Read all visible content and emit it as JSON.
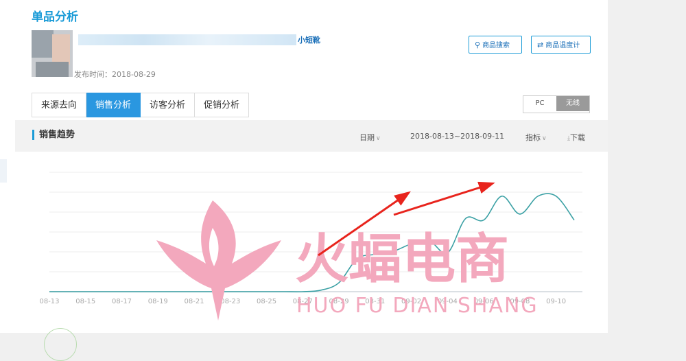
{
  "page": {
    "title": "单品分析",
    "product_name_suffix": "小短靴",
    "publish_date": "发布时间：2018-08-29"
  },
  "buttons": {
    "search_label": "商品搜索",
    "temperature_label": "商品温度计"
  },
  "tabs": [
    {
      "label": "来源去向",
      "active": false
    },
    {
      "label": "销售分析",
      "active": true
    },
    {
      "label": "访客分析",
      "active": false
    },
    {
      "label": "促销分析",
      "active": false
    }
  ],
  "device_toggle": [
    {
      "label": "PC",
      "active": false
    },
    {
      "label": "无线",
      "active": true
    }
  ],
  "trend": {
    "title": "销售趋势",
    "date_label": "日期",
    "date_range": "2018-08-13~2018-09-11",
    "metric_label": "指标",
    "download_label": "下载"
  },
  "colors": {
    "accent": "#1a9bd7",
    "tab_active": "#2a97e0",
    "line": "#3aa0a4",
    "arrow": "#e8241d",
    "watermark": "#f3a8bd"
  },
  "chart_data": {
    "type": "line",
    "x_tick_labels": [
      "08-13",
      "08-15",
      "08-17",
      "08-19",
      "08-21",
      "08-23",
      "08-25",
      "08-27",
      "08-29",
      "08-31",
      "09-02",
      "09-04",
      "09-06",
      "09-08",
      "09-10"
    ],
    "x": [
      "08-13",
      "08-14",
      "08-15",
      "08-16",
      "08-17",
      "08-18",
      "08-19",
      "08-20",
      "08-21",
      "08-22",
      "08-23",
      "08-24",
      "08-25",
      "08-26",
      "08-27",
      "08-28",
      "08-29",
      "08-30",
      "08-31",
      "09-01",
      "09-02",
      "09-03",
      "09-04",
      "09-05",
      "09-06",
      "09-07",
      "09-08",
      "09-09",
      "09-10",
      "09-11"
    ],
    "series": [
      {
        "values": [
          0,
          0,
          0,
          0,
          0,
          0,
          0,
          0,
          0,
          0,
          0,
          0,
          0,
          0,
          0,
          0.05,
          0.3,
          1.1,
          1.25,
          1.35,
          1.6,
          1.7,
          1.3,
          2.45,
          2.4,
          3.2,
          2.6,
          3.2,
          3.2,
          2.4
        ]
      }
    ],
    "ylim": [
      0,
      4
    ],
    "grid": true,
    "legend": "none"
  },
  "watermark": {
    "title": "火蝠电商",
    "subtitle": "HUO FU DIAN SHANG"
  },
  "icons": {
    "search": "search-icon",
    "swap": "swap-icon",
    "download": "download-icon",
    "caret": "chevron-down-icon"
  }
}
